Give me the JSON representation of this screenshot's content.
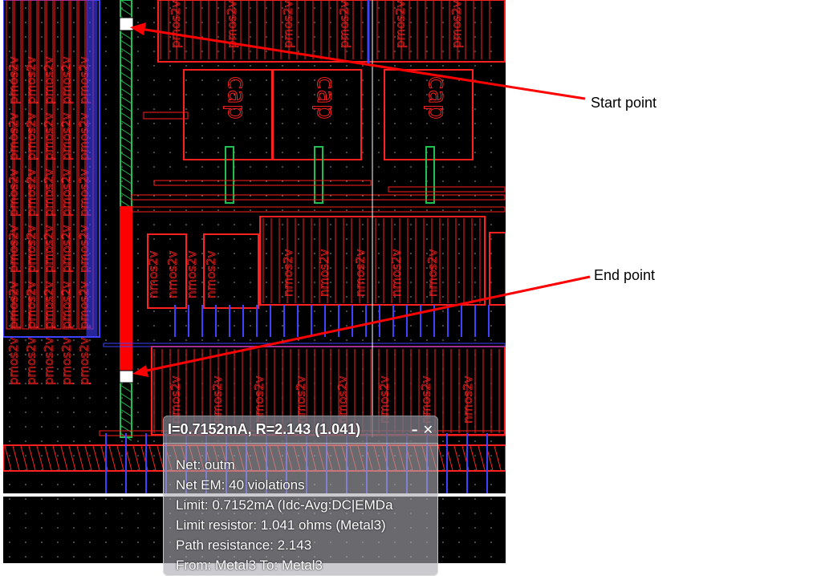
{
  "layout": {
    "device_label": "pmos2v",
    "device_label_2": "nmos2v",
    "cap_label": "cap"
  },
  "callouts": {
    "start": "Start point",
    "end": "End point"
  },
  "popup": {
    "title": "I=0.7152mA, R=2.143 (1.041)",
    "minimize": "–",
    "close": "✕",
    "lines": [
      "Net: outm",
      "Net EM: 40 violations",
      "Limit: 0.7152mA (Idc-Avg:DC|EMDa",
      "Limit resistor: 1.041 ohms (Metal3)",
      "Path resistance: 2.143",
      "From: Metal3 To: Metal3"
    ]
  },
  "colors": {
    "background": "#000000",
    "poly": "#ff2020",
    "metal": "#4040ff",
    "via": "#20c050",
    "highlight_path": "#ff0000"
  }
}
